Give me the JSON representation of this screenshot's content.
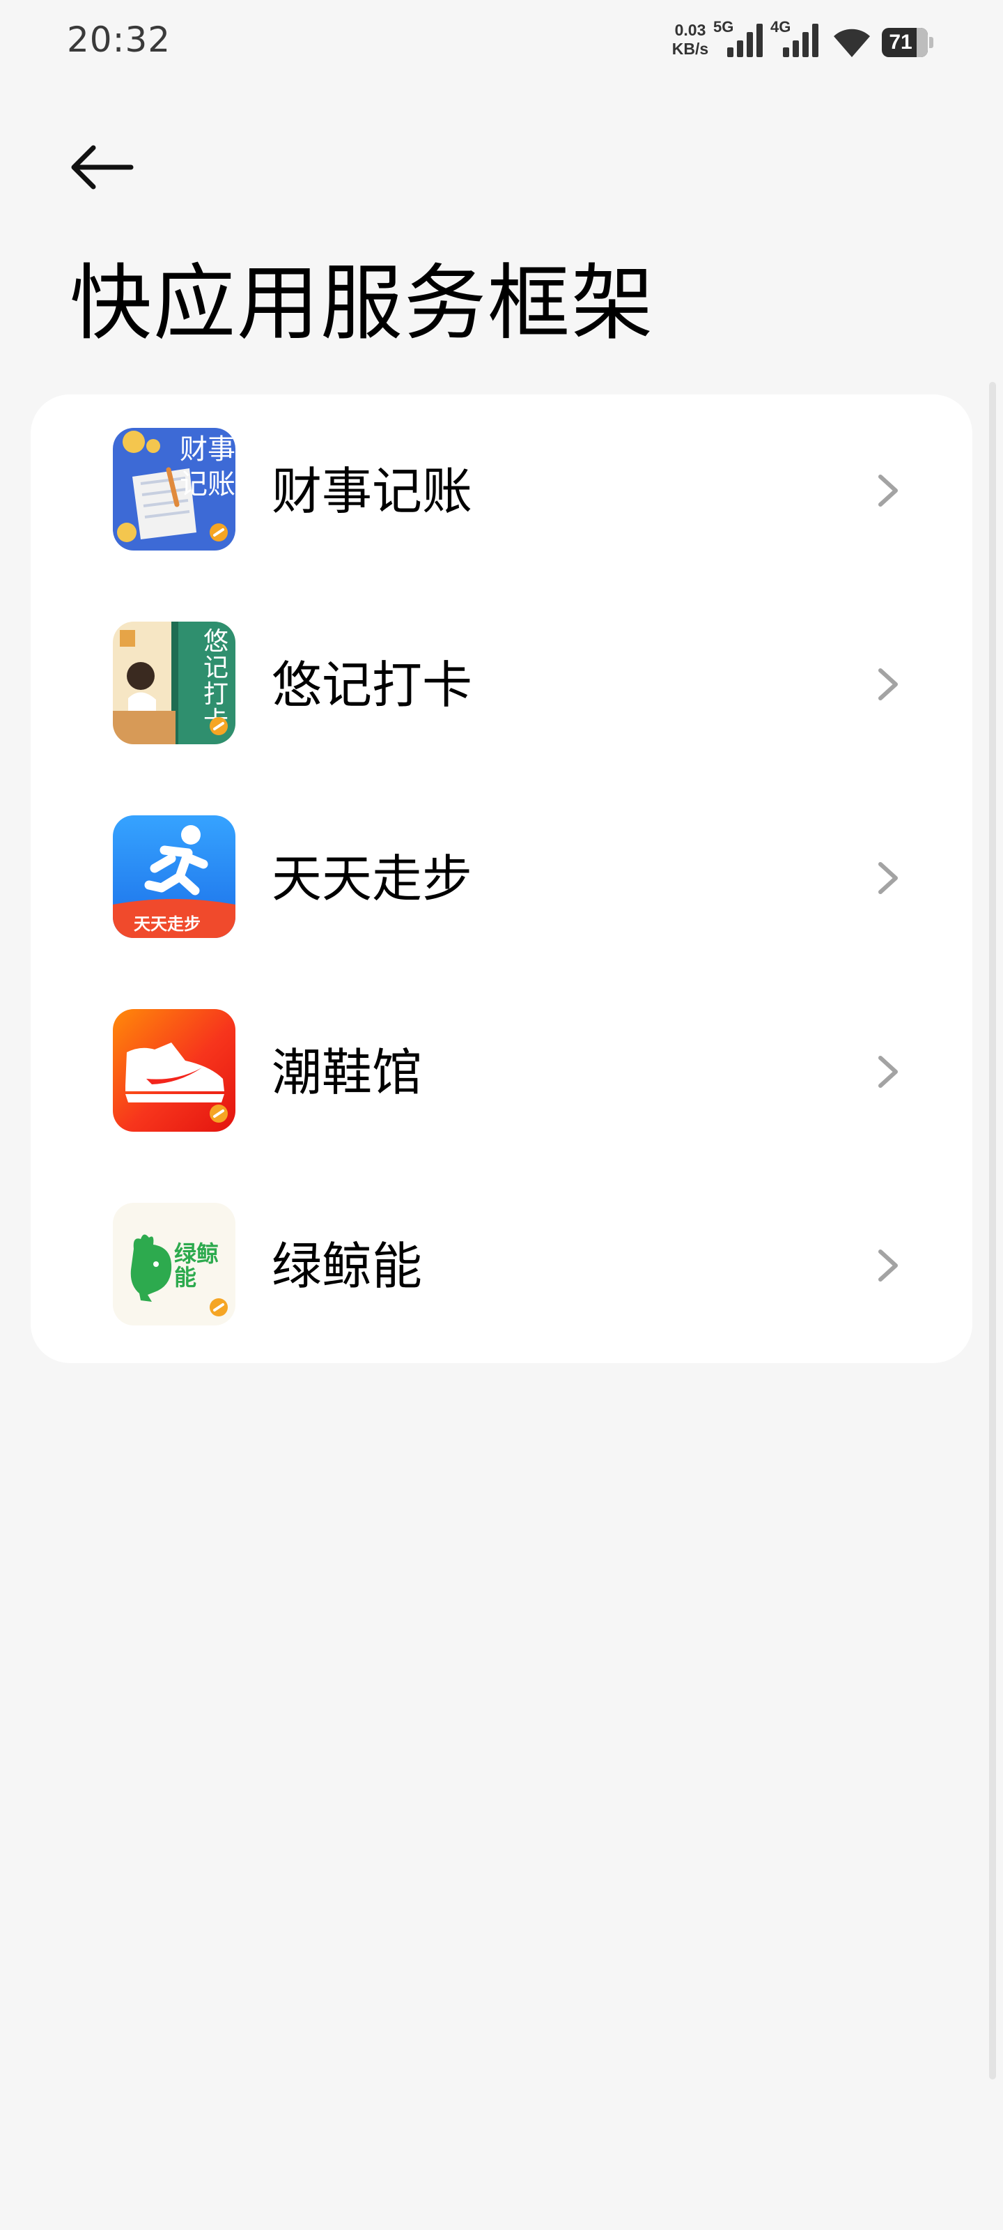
{
  "status_bar": {
    "time": "20:32",
    "net_speed_value": "0.03",
    "net_speed_unit": "KB/s",
    "sim1_type": "5G",
    "sim2_type": "4G",
    "battery_level": "71"
  },
  "header": {
    "title": "快应用服务框架"
  },
  "apps": [
    {
      "name": "财事记账",
      "icon": "cashbook-app-icon"
    },
    {
      "name": "悠记打卡",
      "icon": "checkin-app-icon"
    },
    {
      "name": "天天走步",
      "icon": "walking-app-icon"
    },
    {
      "name": "潮鞋馆",
      "icon": "sneaker-app-icon"
    },
    {
      "name": "绿鲸能",
      "icon": "green-whale-app-icon"
    }
  ],
  "icon_text": {
    "cashbook": "财事记账",
    "checkin": "悠记打卡",
    "walking": "天天走步"
  },
  "colors": {
    "background": "#f6f6f6",
    "card": "#ffffff",
    "walking_blue": "#2f8cf5",
    "sneaker_red": "#f3251c",
    "whale_green": "#2daa4e",
    "quickapp_badge": "#f5a524"
  }
}
